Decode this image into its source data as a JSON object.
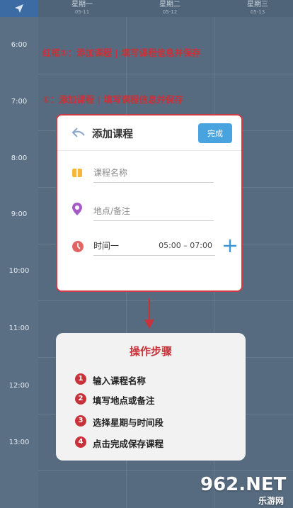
{
  "header": {
    "days": [
      {
        "name": "星期一",
        "date": "05-11"
      },
      {
        "name": "星期二",
        "date": "05-12"
      },
      {
        "name": "星期三",
        "date": "05-13"
      }
    ]
  },
  "times": [
    "6:00",
    "7:00",
    "8:00",
    "9:00",
    "10:00",
    "11:00",
    "12:00",
    "13:00"
  ],
  "notes": {
    "top": "红框①：添加课程 | 填写课程信息并保存",
    "second": "①：添加课程 | 填写课程信息并保存"
  },
  "dialog": {
    "title": "添加课程",
    "done_label": "完成",
    "course_name_placeholder": "课程名称",
    "location_placeholder": "地点/备注",
    "time_label": "时间一",
    "time_range": "05:00 – 07:00"
  },
  "steps": {
    "title": "操作步骤",
    "items": [
      {
        "num": "1",
        "text": "输入课程名称"
      },
      {
        "num": "2",
        "text": "填写地点或备注"
      },
      {
        "num": "3",
        "text": "选择星期与时间段"
      },
      {
        "num": "4",
        "text": "点击完成保存课程"
      }
    ]
  },
  "watermark": {
    "main": "962.NET",
    "sub": "乐游网"
  },
  "colors": {
    "accent_red": "#c8323a",
    "button_blue": "#49a3de",
    "nav_blue": "#3c6aa2"
  }
}
